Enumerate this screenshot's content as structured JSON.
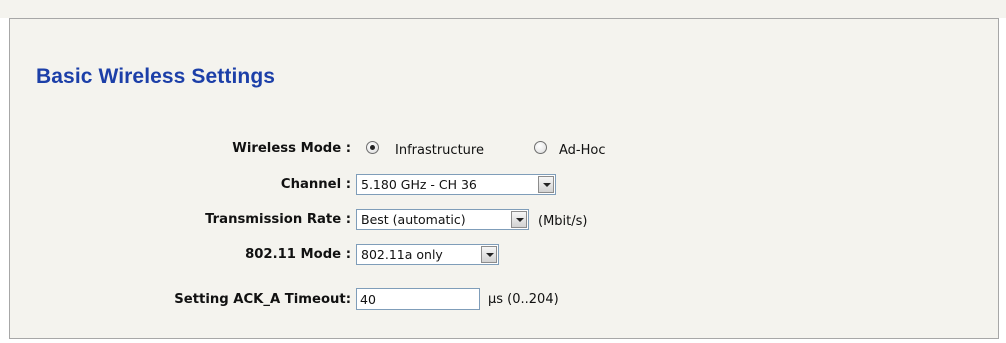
{
  "section": {
    "title": "Basic Wireless Settings"
  },
  "form": {
    "wireless_mode": {
      "label": "Wireless Mode :",
      "options": [
        {
          "text": "Infrastructure",
          "checked": true
        },
        {
          "text": "Ad-Hoc",
          "checked": false
        }
      ]
    },
    "channel": {
      "label": "Channel :",
      "value": "5.180 GHz - CH 36"
    },
    "transmission_rate": {
      "label": "Transmission Rate :",
      "value": "Best (automatic)",
      "unit": "(Mbit/s)"
    },
    "mode_80211": {
      "label": "802.11 Mode :",
      "value": "802.11a only"
    },
    "ack_timeout": {
      "label": "Setting ACK_A Timeout:",
      "value": "40",
      "unit": "µs (0..204)"
    }
  },
  "colors": {
    "title": "#1c3fa8",
    "panel_background": "#f4f3ee",
    "panel_border": "#a7a7a7",
    "field_border": "#7f9db9"
  },
  "icons": {
    "radio_checked": "radio-checked-icon",
    "radio_unchecked": "radio-unchecked-icon",
    "dropdown": "chevron-down-icon"
  }
}
